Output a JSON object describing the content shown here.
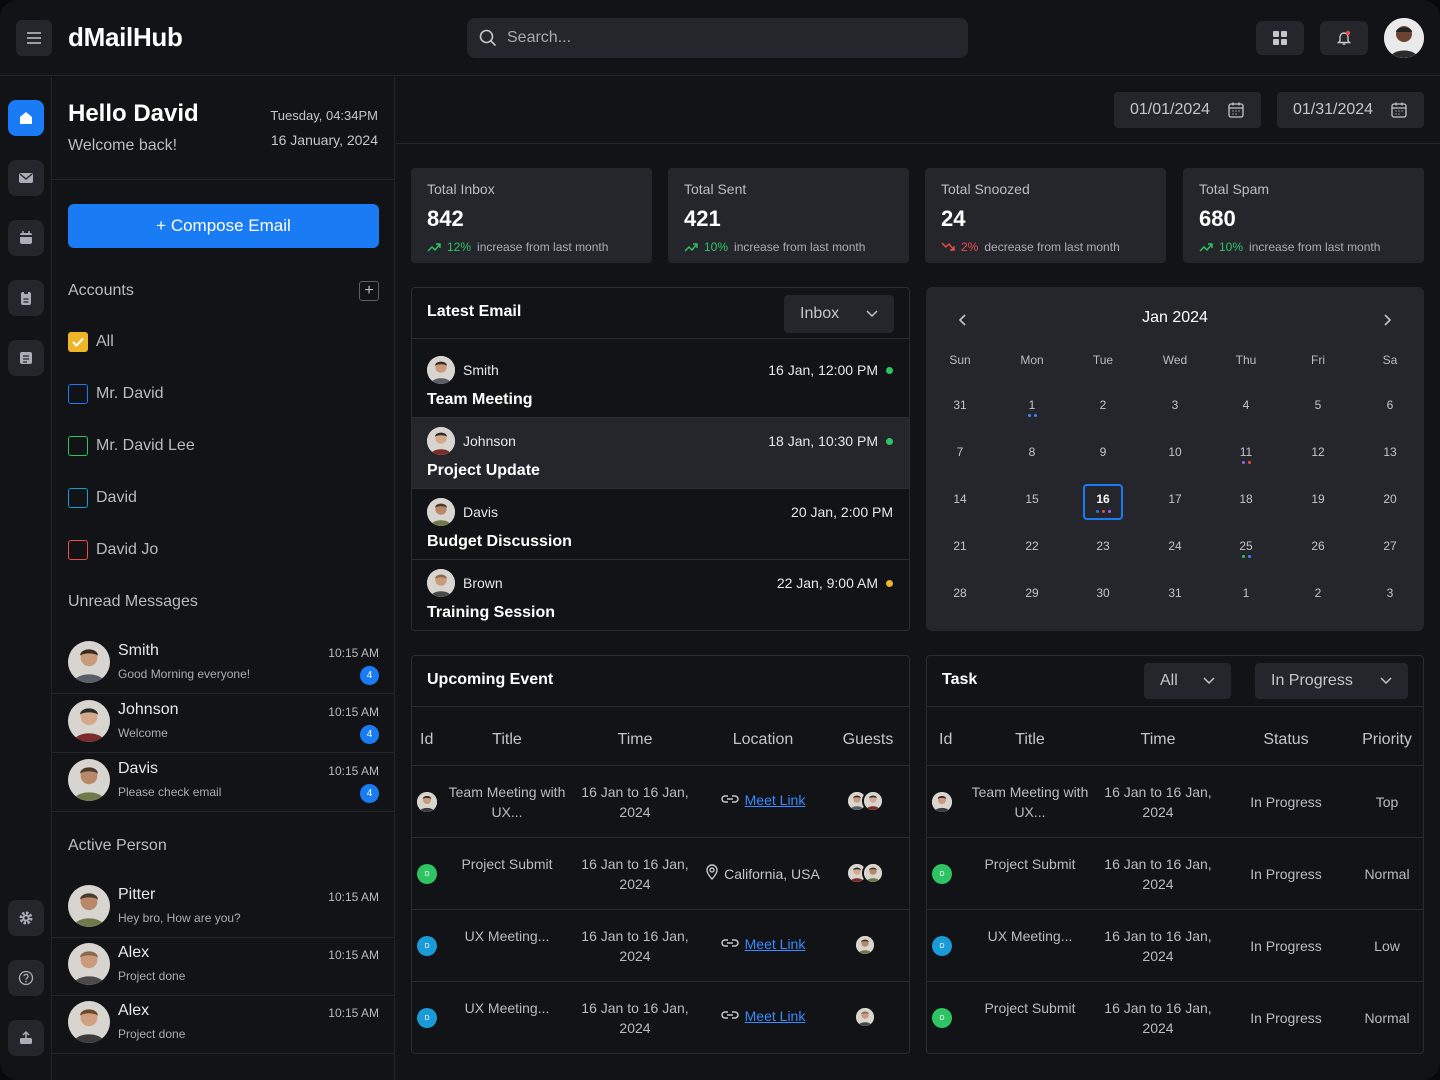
{
  "header": {
    "app_title": "dMailHub",
    "search_placeholder": "Search..."
  },
  "greeting": {
    "hello": "Hello David",
    "welcome": "Welcome back!",
    "day_time": "Tuesday, 04:34PM",
    "date": "16 January, 2024"
  },
  "compose_label": "+ Compose Email",
  "accounts": {
    "title": "Accounts",
    "items": [
      {
        "label": "All",
        "checked": true,
        "color": "#f0b429"
      },
      {
        "label": "Mr. David",
        "checked": false,
        "color": "#1a7cf5"
      },
      {
        "label": "Mr. David Lee",
        "checked": false,
        "color": "#2fc463"
      },
      {
        "label": "David",
        "checked": false,
        "color": "#1a9bd7"
      },
      {
        "label": "David Jo",
        "checked": false,
        "color": "#ef4b4b"
      }
    ]
  },
  "unread": {
    "title": "Unread Messages",
    "items": [
      {
        "name": "Smith",
        "snippet": "Good Morning everyone!",
        "time": "10:15 AM",
        "count": "4"
      },
      {
        "name": "Johnson",
        "snippet": "Welcome",
        "time": "10:15 AM",
        "count": "4"
      },
      {
        "name": "Davis",
        "snippet": "Please check email",
        "time": "10:15 AM",
        "count": "4"
      }
    ]
  },
  "active": {
    "title": "Active Person",
    "items": [
      {
        "name": "Pitter",
        "snippet": "Hey bro, How are you?",
        "time": "10:15 AM"
      },
      {
        "name": "Alex",
        "snippet": "Project done",
        "time": "10:15 AM"
      },
      {
        "name": "Alex",
        "snippet": "Project done",
        "time": "10:15 AM"
      }
    ]
  },
  "date_range": {
    "from": "01/01/2024",
    "to": "01/31/2024"
  },
  "stats": [
    {
      "label": "Total Inbox",
      "value": "842",
      "change": "12%",
      "direction": "up",
      "note": "increase from last month"
    },
    {
      "label": "Total Sent",
      "value": "421",
      "change": "10%",
      "direction": "up",
      "note": "increase from last month"
    },
    {
      "label": "Total Snoozed",
      "value": "24",
      "change": "2%",
      "direction": "down",
      "note": "decrease from last month"
    },
    {
      "label": "Total Spam",
      "value": "680",
      "change": "10%",
      "direction": "up",
      "note": "increase from last month"
    }
  ],
  "latest": {
    "title": "Latest Email",
    "filter": "Inbox",
    "items": [
      {
        "sender": "Smith",
        "subject": "Team Meeting",
        "time": "16 Jan, 12:00 PM",
        "status_color": "#2fc463"
      },
      {
        "sender": "Johnson",
        "subject": "Project Update",
        "time": "18 Jan, 10:30 PM",
        "status_color": "#2fc463"
      },
      {
        "sender": "Davis",
        "subject": "Budget Discussion",
        "time": "20 Jan, 2:00 PM",
        "status_color": ""
      },
      {
        "sender": "Brown",
        "subject": "Training Session",
        "time": "22 Jan, 9:00 AM",
        "status_color": "#f0b429"
      }
    ]
  },
  "calendar": {
    "title": "Jan 2024",
    "weekdays": [
      "Sun",
      "Mon",
      "Tue",
      "Wed",
      "Thu",
      "Fri",
      "Sa"
    ],
    "days": [
      "31",
      "1",
      "2",
      "3",
      "4",
      "5",
      "6",
      "7",
      "8",
      "9",
      "10",
      "11",
      "12",
      "13",
      "14",
      "15",
      "16",
      "17",
      "18",
      "19",
      "20",
      "21",
      "22",
      "23",
      "24",
      "25",
      "26",
      "27",
      "28",
      "29",
      "30",
      "31",
      "1",
      "2",
      "3"
    ],
    "today": "16"
  },
  "events": {
    "title": "Upcoming Event",
    "columns": [
      "Id",
      "Title",
      "Time",
      "Location",
      "Guests"
    ],
    "rows": [
      {
        "id_letter": "",
        "title": "Team Meeting with UX...",
        "time": "16 Jan to 16 Jan, 2024",
        "location": "Meet Link",
        "location_type": "link"
      },
      {
        "id_letter": "D",
        "title": "Project Submit",
        "time": "16 Jan to 16 Jan, 2024",
        "location": "California, USA",
        "location_type": "place"
      },
      {
        "id_letter": "D",
        "title": "UX Meeting...",
        "time": "16 Jan to 16 Jan, 2024",
        "location": "Meet Link",
        "location_type": "link"
      },
      {
        "id_letter": "D",
        "title": "UX Meeting...",
        "time": "16 Jan to 16 Jan, 2024",
        "location": "Meet Link",
        "location_type": "link"
      }
    ]
  },
  "tasks": {
    "title": "Task",
    "filter_all": "All",
    "filter_status": "In Progress",
    "columns": [
      "Id",
      "Title",
      "Time",
      "Status",
      "Priority"
    ],
    "rows": [
      {
        "id_letter": "",
        "title": "Team Meeting with UX...",
        "time": "16 Jan to 16 Jan, 2024",
        "status": "In Progress",
        "priority": "Top"
      },
      {
        "id_letter": "D",
        "title": "Project Submit",
        "time": "16 Jan to 16 Jan, 2024",
        "status": "In Progress",
        "priority": "Normal"
      },
      {
        "id_letter": "D",
        "title": "UX Meeting...",
        "time": "16 Jan to 16 Jan, 2024",
        "status": "In Progress",
        "priority": "Low"
      },
      {
        "id_letter": "D",
        "title": "Project Submit",
        "time": "16 Jan to 16 Jan, 2024",
        "status": "In Progress",
        "priority": "Normal"
      }
    ]
  }
}
